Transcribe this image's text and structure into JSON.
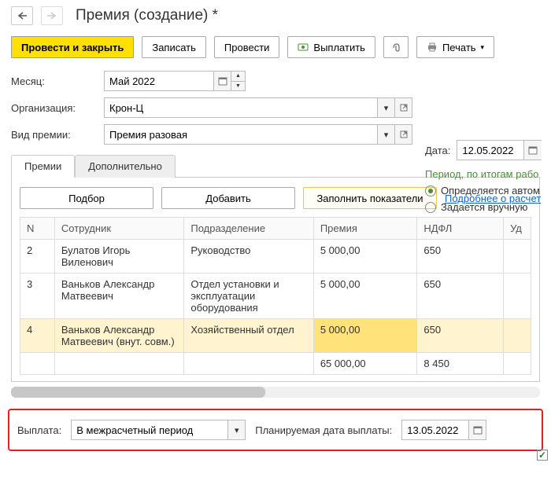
{
  "header": {
    "title": "Премия (создание) *"
  },
  "toolbar": {
    "submit": "Провести и закрыть",
    "save": "Записать",
    "post": "Провести",
    "pay": "Выплатить",
    "print": "Печать"
  },
  "form": {
    "month_label": "Месяц:",
    "month_value": "Май 2022",
    "org_label": "Организация:",
    "org_value": "Крон-Ц",
    "type_label": "Вид премии:",
    "type_value": "Премия разовая",
    "date_label": "Дата:",
    "date_value": "12.05.2022"
  },
  "period": {
    "title": "Период, по итогам рабо",
    "opt_auto": "Определяется автом",
    "opt_manual": "Задается вручную"
  },
  "tabs": {
    "bonuses": "Премии",
    "extra": "Дополнительно"
  },
  "tabToolbar": {
    "pick": "Подбор",
    "add": "Добавить",
    "fill": "Заполнить показатели",
    "more": "Подробнее о расчет"
  },
  "table": {
    "headers": {
      "n": "N",
      "emp": "Сотрудник",
      "dept": "Подразделение",
      "bonus": "Премия",
      "tax": "НДФЛ",
      "withheld": "Уд"
    },
    "rows": [
      {
        "n": "2",
        "emp": "Булатов Игорь Виленович",
        "dept": "Руководство",
        "bonus": "5 000,00",
        "tax": "650"
      },
      {
        "n": "3",
        "emp": "Ваньков Александр Матвеевич",
        "dept": "Отдел установки и эксплуатации оборудования",
        "bonus": "5 000,00",
        "tax": "650"
      },
      {
        "n": "4",
        "emp": "Ваньков Александр Матвеевич (внут. совм.)",
        "dept": "Хозяйственный отдел",
        "bonus": "5 000,00",
        "tax": "650"
      }
    ],
    "totals": {
      "bonus": "65 000,00",
      "tax": "8 450"
    }
  },
  "footer": {
    "payout_label": "Выплата:",
    "payout_value": "В межрасчетный период",
    "plan_date_label": "Планируемая дата выплаты:",
    "plan_date_value": "13.05.2022"
  }
}
